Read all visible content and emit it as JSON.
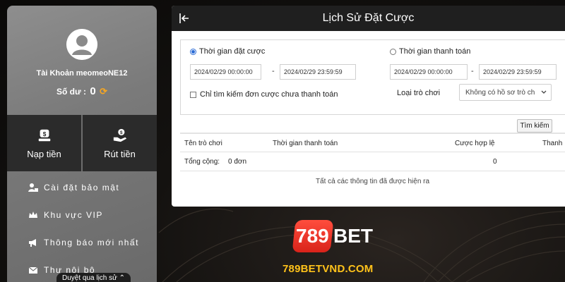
{
  "sidebar": {
    "account_label": "Tài Khoản meomeoNE12",
    "balance_label": "Số dư :",
    "balance_value": "0",
    "actions": [
      {
        "label": "Nạp tiền",
        "icon": "deposit-icon"
      },
      {
        "label": "Rút tiền",
        "icon": "withdraw-icon"
      }
    ],
    "menu": [
      {
        "label": "Cài đặt bảo mật",
        "icon": "user-lock-icon"
      },
      {
        "label": "Khu vực VIP",
        "icon": "crown-icon"
      },
      {
        "label": "Thông báo mới nhất",
        "icon": "megaphone-icon"
      },
      {
        "label": "Thư nội bộ",
        "icon": "envelope-icon"
      }
    ],
    "history_bar": "Duyệt qua lịch sử"
  },
  "panel": {
    "title": "Lịch Sử Đặt Cược",
    "radio_bet_time": "Thời gian đặt cược",
    "radio_pay_time": "Thời gian thanh toán",
    "bet_from": "2024/02/29 00:00:00",
    "bet_to": "2024/02/29 23:59:59",
    "pay_from": "2024/02/29 00:00:00",
    "pay_to": "2024/02/29 23:59:59",
    "dash": "-",
    "unpaid_only": "Chỉ tìm kiếm đơn cược chưa thanh toán",
    "game_type_label": "Loại trò chơi",
    "game_type_value": "Không có hồ sơ trò ch",
    "search_button": "Tìm kiếm",
    "columns": [
      "Tên trò chơi",
      "Thời gian thanh toán",
      "Cược hợp lệ",
      "Thanh"
    ],
    "total_label": "Tổng cộng:",
    "total_orders": "0 đơn",
    "total_valid": "0",
    "all_shown": "Tất cả các thông tin đã được hiện ra"
  },
  "brand": {
    "logo_num": "789",
    "logo_bet": "BET",
    "site": "789BETVND.COM",
    "accent": "#e8291c",
    "site_color": "#ffc21a"
  }
}
